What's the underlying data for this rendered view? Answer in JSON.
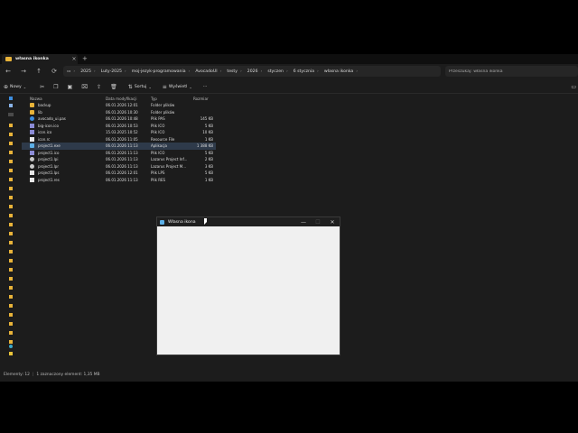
{
  "tab": {
    "title": "własna ikonka",
    "close": "×",
    "add": "+"
  },
  "nav": {
    "back": "←",
    "forward": "→",
    "up": "↑",
    "refresh": "⟳",
    "desktop": "▭",
    "chevron": "›"
  },
  "breadcrumbs": [
    "2025",
    "Luty-2025",
    "moj-jezyk-programowania",
    "AvocadoUI",
    "testy",
    "2026",
    "styczen",
    "6 stycznia",
    "własna ikonka"
  ],
  "search": {
    "placeholder": "Przeszukaj: własna ikonka"
  },
  "toolbar": {
    "new_label": "Nowy",
    "sort_label": "Sortuj",
    "view_label": "Wyświetl",
    "more": "⋯"
  },
  "columns": {
    "name": "Nazwa",
    "date": "Data modyfikacji",
    "type": "Typ",
    "size": "Rozmiar"
  },
  "files": [
    {
      "name": "backup",
      "date": "06.01.2026 12:01",
      "type": "Folder plików",
      "size": "",
      "icon": "folder"
    },
    {
      "name": "lib",
      "date": "06.01.2026 10:30",
      "type": "Folder plików",
      "size": "",
      "icon": "folder"
    },
    {
      "name": "avocado_ui.pas",
      "date": "06.01.2026 10:48",
      "type": "Plik PAS",
      "size": "145 KB",
      "icon": "pas"
    },
    {
      "name": "big-icon.ico",
      "date": "06.01.2026 10:53",
      "type": "Plik ICO",
      "size": "5 KB",
      "icon": "ico"
    },
    {
      "name": "icon.ico",
      "date": "15.03.2025 10:52",
      "type": "Plik ICO",
      "size": "10 KB",
      "icon": "ico"
    },
    {
      "name": "icon.rc",
      "date": "06.01.2026 11:05",
      "type": "Resource File",
      "size": "1 KB",
      "icon": "doc"
    },
    {
      "name": "project1.exe",
      "date": "06.01.2026 11:13",
      "type": "Aplikacja",
      "size": "1 388 KB",
      "icon": "exe"
    },
    {
      "name": "project1.ico",
      "date": "06.01.2026 11:13",
      "type": "Plik ICO",
      "size": "5 KB",
      "icon": "ico"
    },
    {
      "name": "project1.lpi",
      "date": "06.01.2026 11:13",
      "type": "Lazarus Project Inf...",
      "size": "2 KB",
      "icon": "lpi"
    },
    {
      "name": "project1.lpr",
      "date": "06.01.2026 11:13",
      "type": "Lazarus Project M...",
      "size": "3 KB",
      "icon": "lpi"
    },
    {
      "name": "project1.lps",
      "date": "06.01.2026 12:01",
      "type": "Plik LPS",
      "size": "5 KB",
      "icon": "doc"
    },
    {
      "name": "project1.res",
      "date": "06.01.2026 11:13",
      "type": "Plik RES",
      "size": "1 KB",
      "icon": "doc"
    }
  ],
  "status": {
    "count": "Elementy: 12",
    "selected": "1 zaznaczony element: 1,35 MB"
  },
  "app_window": {
    "title": "Własna ikona",
    "minimize": "—",
    "maximize": "☐",
    "close": "✕"
  },
  "colors": {
    "folder": "#e8b339",
    "window_client": "#f0f0f0",
    "selection": "#2e3a4a"
  }
}
